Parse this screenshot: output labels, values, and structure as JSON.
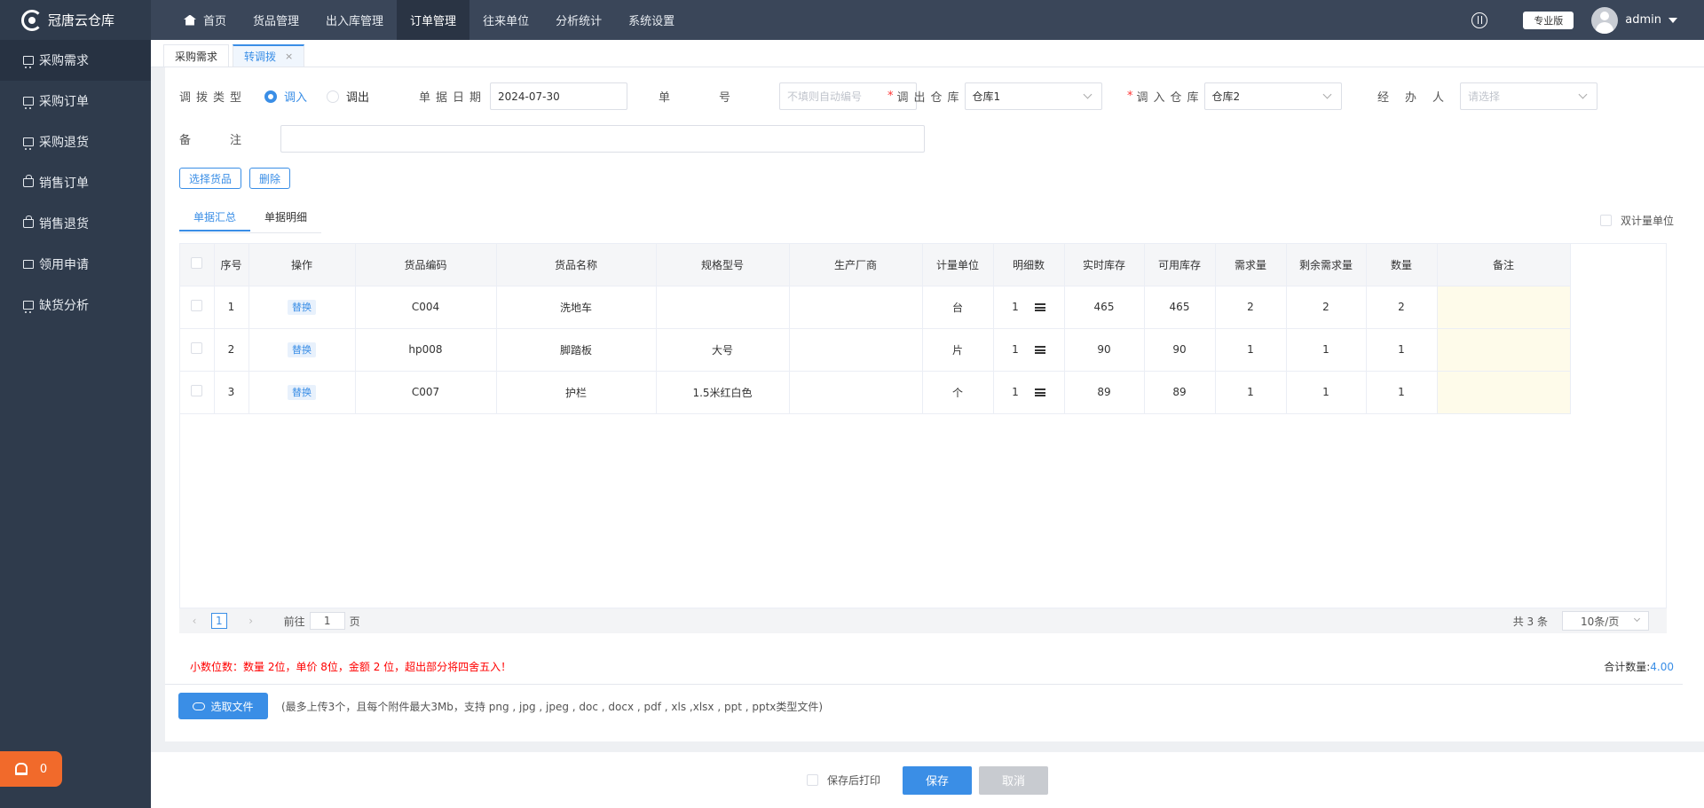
{
  "app": {
    "title": "冠唐云仓库"
  },
  "sidebar": {
    "items": [
      {
        "label": "采购需求",
        "icon": "cart"
      },
      {
        "label": "采购订单",
        "icon": "cart"
      },
      {
        "label": "采购退货",
        "icon": "cart"
      },
      {
        "label": "销售订单",
        "icon": "bag"
      },
      {
        "label": "销售退货",
        "icon": "bag"
      },
      {
        "label": "领用申请",
        "icon": "box"
      },
      {
        "label": "缺货分析",
        "icon": "cart"
      }
    ],
    "alarm_count": "0"
  },
  "topnav": {
    "items": [
      "首页",
      "货品管理",
      "出入库管理",
      "订单管理",
      "往来单位",
      "分析统计",
      "系统设置"
    ],
    "edition": "专业版",
    "user": "admin"
  },
  "tabs": [
    {
      "label": "采购需求"
    },
    {
      "label": "转调拨",
      "close": "×"
    }
  ],
  "form": {
    "type_label": "调拨类型",
    "type_in": "调入",
    "type_out": "调出",
    "date_label": "单据日期",
    "date_value": "2024-07-30",
    "no_label": "单号",
    "no_placeholder": "不填则自动编号",
    "out_wh_label": "调出仓库",
    "out_wh_value": "仓库1",
    "in_wh_label": "调入仓库",
    "in_wh_value": "仓库2",
    "handler_label": "经办人",
    "handler_placeholder": "请选择",
    "note_label": "备注",
    "select_goods": "选择货品",
    "delete": "删除"
  },
  "subtabs": {
    "summary": "单据汇总",
    "detail": "单据明细",
    "dual_unit": "双计量单位"
  },
  "table": {
    "headers": [
      "序号",
      "操作",
      "货品编码",
      "货品名称",
      "规格型号",
      "生产厂商",
      "计量单位",
      "明细数",
      "实时库存",
      "可用库存",
      "需求量",
      "剩余需求量",
      "数量",
      "备注"
    ],
    "rows": [
      {
        "no": "1",
        "op": "替换",
        "code": "C004",
        "name": "洗地车",
        "spec": "",
        "maker": "",
        "unit": "台",
        "detail": "1",
        "stock": "465",
        "avail": "465",
        "need": "2",
        "remain": "2",
        "qty": "2"
      },
      {
        "no": "2",
        "op": "替换",
        "code": "hp008",
        "name": "脚踏板",
        "spec": "大号",
        "maker": "",
        "unit": "片",
        "detail": "1",
        "stock": "90",
        "avail": "90",
        "need": "1",
        "remain": "1",
        "qty": "1"
      },
      {
        "no": "3",
        "op": "替换",
        "code": "C007",
        "name": "护栏",
        "spec": "1.5米红白色",
        "maker": "",
        "unit": "个",
        "detail": "1",
        "stock": "89",
        "avail": "89",
        "need": "1",
        "remain": "1",
        "qty": "1"
      }
    ]
  },
  "pager": {
    "prev": "‹",
    "page": "1",
    "next": "›",
    "goto_pre": "前往",
    "goto_value": "1",
    "goto_post": "页",
    "total": "共 3 条",
    "size": "10条/页"
  },
  "warn": "小数位数：数量 2位，单价 8位，金额 2 位，超出部分将四舍五入！",
  "total": {
    "label": "合计数量:",
    "value": "4.00"
  },
  "upload": {
    "label": "选取文件",
    "hint": "(最多上传3个，且每个附件最大3Mb，支持 png , jpg , jpeg , doc , docx , pdf , xls ,xlsx , ppt , pptx类型文件)"
  },
  "footer": {
    "print": "保存后打印",
    "save": "保存",
    "cancel": "取消"
  }
}
